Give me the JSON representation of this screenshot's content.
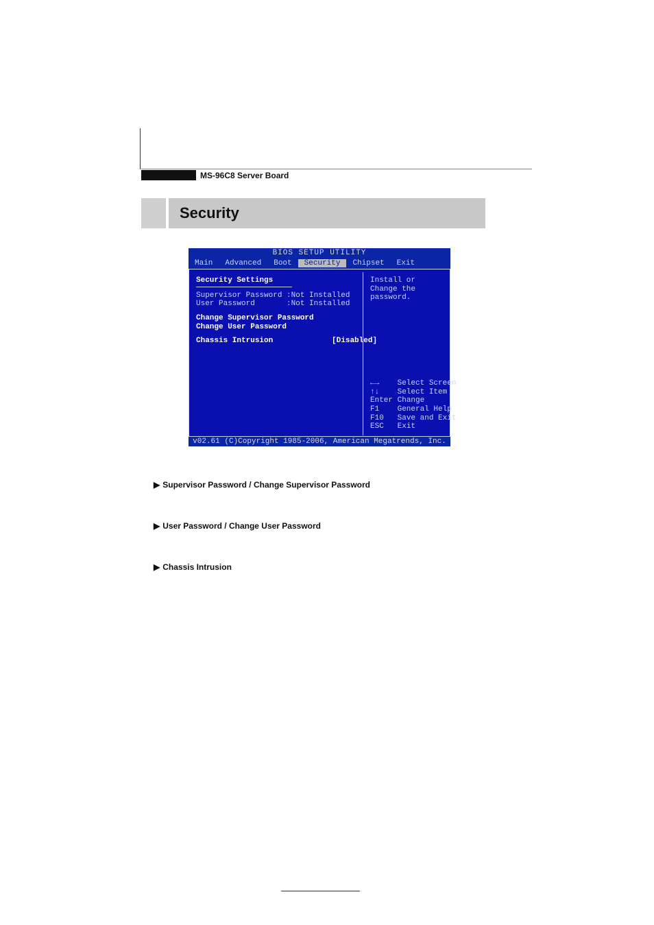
{
  "page": {
    "board_title": "MS-96C8 Server Board",
    "section_heading": "Security"
  },
  "bios": {
    "utility_title": "BIOS SETUP UTILITY",
    "tabs": [
      "Main",
      "Advanced",
      "Boot",
      "Security",
      "Chipset",
      "Exit"
    ],
    "active_tab_index": 3,
    "left": {
      "title": "Security Settings",
      "status": [
        {
          "label": "Supervisor Password",
          "value": "Not Installed"
        },
        {
          "label": "User Password",
          "value": "Not Installed"
        }
      ],
      "actions": [
        "Change Supervisor Password",
        "Change User Password"
      ],
      "option": {
        "label": "Chassis Intrusion",
        "value": "[Disabled]"
      }
    },
    "right": {
      "hint": "Install or Change the password.",
      "help": [
        {
          "key": "←→",
          "label": "Select Screen"
        },
        {
          "key": "↑↓",
          "label": "Select Item"
        },
        {
          "key": "Enter",
          "label": "Change"
        },
        {
          "key": "F1",
          "label": "General Help"
        },
        {
          "key": "F10",
          "label": "Save and Exit"
        },
        {
          "key": "ESC",
          "label": "Exit"
        }
      ]
    },
    "footer": "v02.61 (C)Copyright 1985-2006, American Megatrends, Inc."
  },
  "doc_items": [
    "Supervisor Password / Change Supervisor Password",
    "User Password / Change User Password",
    "Chassis Intrusion"
  ]
}
